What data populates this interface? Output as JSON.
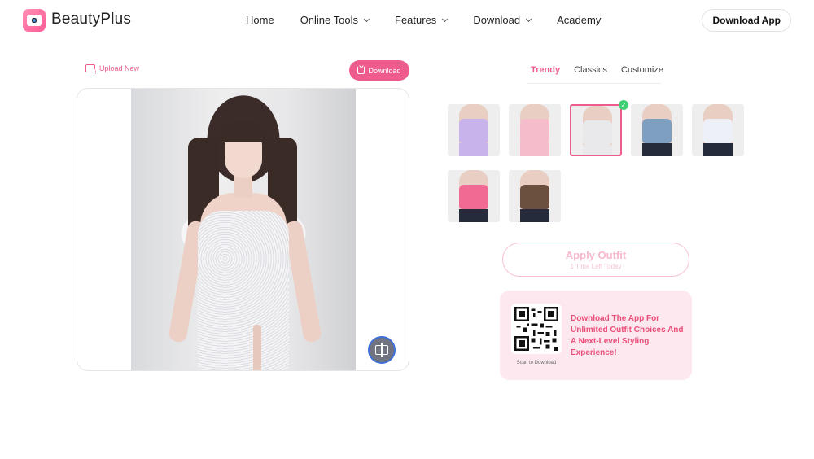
{
  "header": {
    "brand": "BeautyPlus",
    "nav": [
      {
        "label": "Home",
        "has_dropdown": false
      },
      {
        "label": "Online Tools",
        "has_dropdown": true
      },
      {
        "label": "Features",
        "has_dropdown": true
      },
      {
        "label": "Download",
        "has_dropdown": true
      },
      {
        "label": "Academy",
        "has_dropdown": false
      }
    ],
    "download_app": "Download App"
  },
  "editor": {
    "upload_new": "Upload New",
    "download": "Download",
    "compare_icon": "compare-icon"
  },
  "outfits": {
    "tabs": [
      {
        "label": "Trendy",
        "active": true
      },
      {
        "label": "Classics",
        "active": false
      },
      {
        "label": "Customize",
        "active": false
      }
    ],
    "thumbnails": [
      {
        "name": "lavender-slip-dress",
        "top": "#c8b3ea",
        "bottom": "#c8b3ea",
        "selected": false
      },
      {
        "name": "pink-satin-dress",
        "top": "#f5bccb",
        "bottom": "#f5bccb",
        "selected": false
      },
      {
        "name": "white-sequin-dress",
        "top": "#e9e9ec",
        "bottom": "#e9e9ec",
        "selected": true
      },
      {
        "name": "denim-corset-top",
        "top": "#7f9fc0",
        "bottom": "#252b3a",
        "selected": false
      },
      {
        "name": "white-bralette-top",
        "top": "#eef0f8",
        "bottom": "#252b3a",
        "selected": false
      },
      {
        "name": "pink-heart-top",
        "top": "#f06a93",
        "bottom": "#252b3a",
        "selected": false
      },
      {
        "name": "brown-halter-top",
        "top": "#6b5040",
        "bottom": "#252b3a",
        "selected": false
      }
    ]
  },
  "apply": {
    "label": "Apply Outfit",
    "sub": "1 Time Left Today"
  },
  "promo": {
    "qr_caption": "Scan to Download",
    "text": "Download The App For Unlimited Outfit Choices And A Next-Level Styling Experience!",
    "accent": "#e8507a"
  }
}
